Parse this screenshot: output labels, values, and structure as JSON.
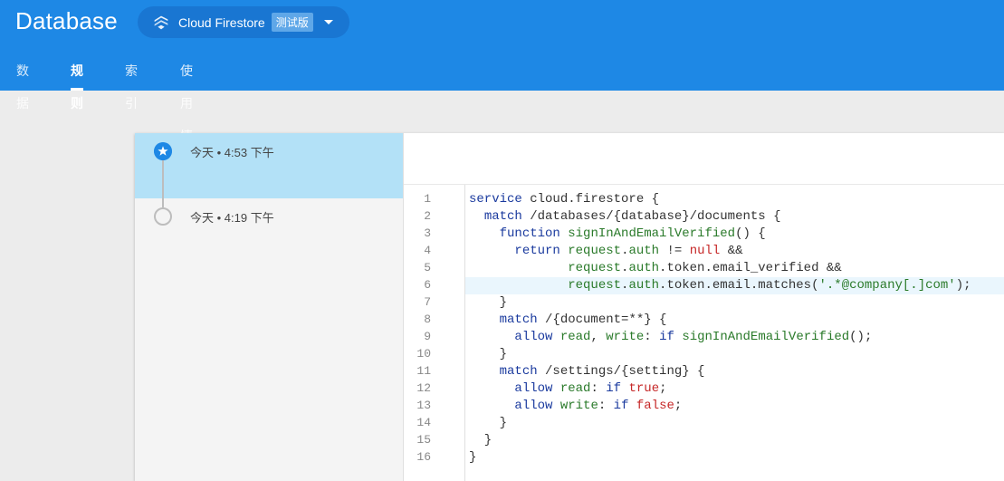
{
  "header": {
    "title": "Database",
    "db_selector": {
      "name": "Cloud Firestore",
      "badge": "测试版",
      "icon": "firestore-icon"
    },
    "tabs": [
      {
        "label": "数据",
        "active": false
      },
      {
        "label": "规则",
        "active": true
      },
      {
        "label": "索引",
        "active": false
      },
      {
        "label": "使用情况",
        "active": false
      }
    ]
  },
  "history": {
    "revisions": [
      {
        "label": "今天 • 4:53 下午",
        "selected": true,
        "icon": "star-icon"
      },
      {
        "label": "今天 • 4:19 下午",
        "selected": false,
        "icon": "circle-icon"
      }
    ]
  },
  "editor": {
    "highlighted_line": 6,
    "lines": [
      "service cloud.firestore {",
      "  match /databases/{database}/documents {",
      "    function signInAndEmailVerified() {",
      "      return request.auth != null &&",
      "             request.auth.token.email_verified &&",
      "             request.auth.token.email.matches('.*@company[.]com');",
      "    }",
      "    match /{document=**} {",
      "      allow read, write: if signInAndEmailVerified();",
      "    }",
      "    match /settings/{setting} {",
      "      allow read: if true;",
      "      allow write: if false;",
      "    }",
      "  }",
      "}"
    ]
  },
  "colors": {
    "header_bg": "#1e88e5",
    "selected_revision": "#b3e1f7",
    "keyword": "#1a3a9e",
    "identifier": "#2a7a2a",
    "literal": "#c62828"
  }
}
